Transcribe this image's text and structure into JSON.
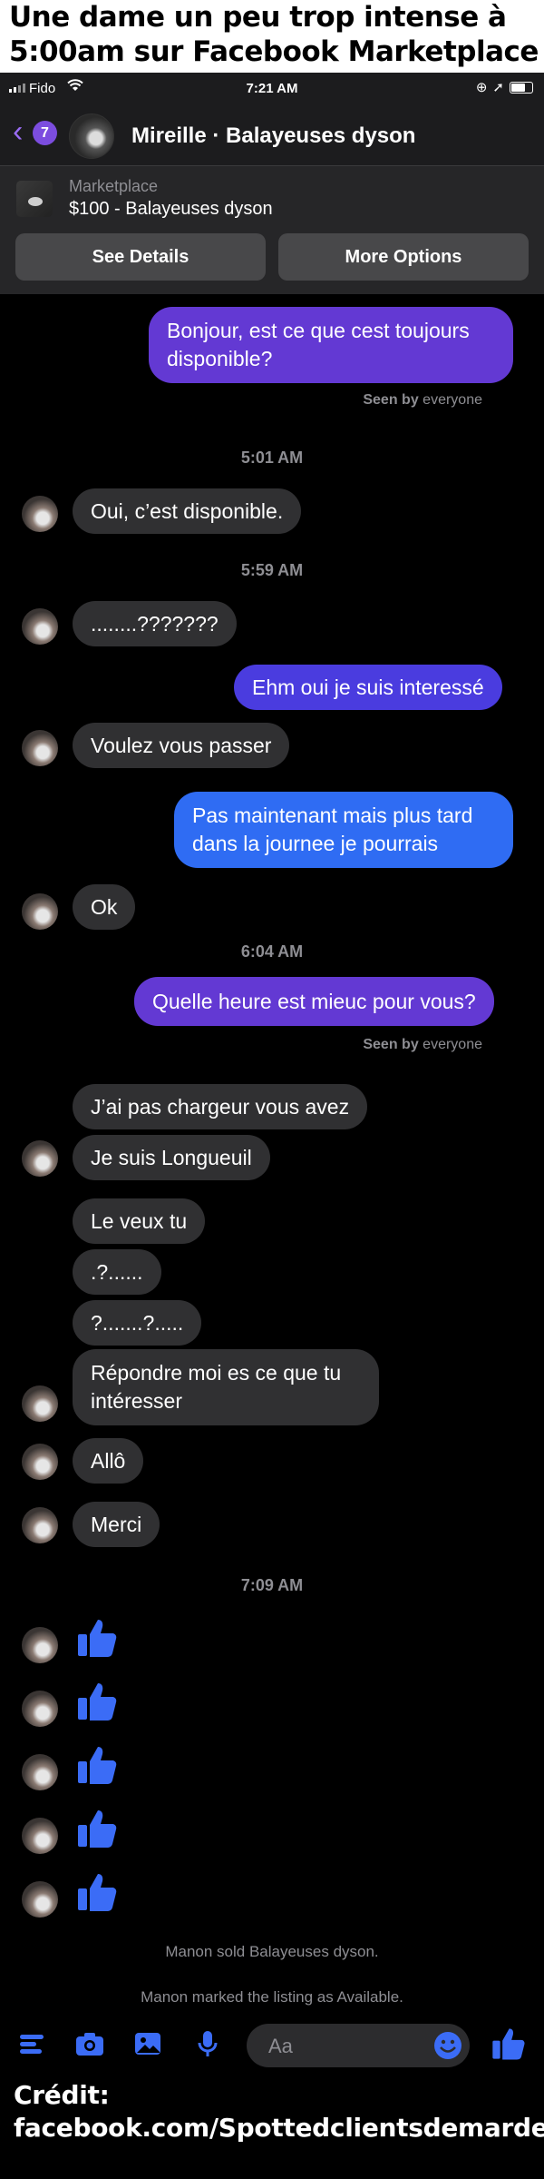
{
  "top_caption": {
    "line1": "Une dame un peu trop intense à",
    "line2": "5:00am sur Facebook Marketplace"
  },
  "status_bar": {
    "carrier": "Fido",
    "time": "7:21 AM",
    "signal_icon": "signal-bars-icon",
    "wifi_icon": "wifi-icon",
    "battery_icon": "battery-icon"
  },
  "header": {
    "unread_count": "7",
    "title": "Mireille · Balayeuses dyson"
  },
  "listing": {
    "source": "Marketplace",
    "price_title": "$100 - Balayeuses dyson",
    "see_details": "See Details",
    "more_options": "More Options"
  },
  "messages": {
    "m1": "Bonjour, est ce que cest toujours disponible?",
    "seen1_prefix": "Seen by",
    "seen1_suffix": "everyone",
    "ts1": "5:01 AM",
    "m2": "Oui, c’est disponible.",
    "ts2": "5:59 AM",
    "m3": "........???????",
    "m4": "Ehm oui je suis interessé",
    "m5": "Voulez vous passer",
    "m6": "Pas maintenant mais plus tard dans la journee je pourrais",
    "m7": "Ok",
    "ts3": "6:04 AM",
    "m8": "Quelle heure est mieuc pour vous?",
    "seen2_prefix": "Seen by",
    "seen2_suffix": "everyone",
    "m9": "J’ai pas chargeur vous avez",
    "m10": "Je suis Longueuil",
    "m11": "Le veux tu",
    "m12": ".?......",
    "m13": "?.......?.....",
    "m14": "Répondre moi es ce que tu intéresser",
    "m15": "Allô",
    "m16": "Merci",
    "ts4": "7:09 AM"
  },
  "system": {
    "sold": "Manon sold Balayeuses dyson.",
    "available": "Manon marked the listing as Available."
  },
  "composer": {
    "placeholder": "Aa"
  },
  "bottom_caption": {
    "line1": "Crédit:",
    "line2": "facebook.com/Spottedclientsdemarde"
  },
  "colors": {
    "accent_purple": "#6339d3",
    "accent_blue": "#2f6cf3",
    "like_blue": "#3b6cf6",
    "incoming_bubble": "#303032"
  }
}
